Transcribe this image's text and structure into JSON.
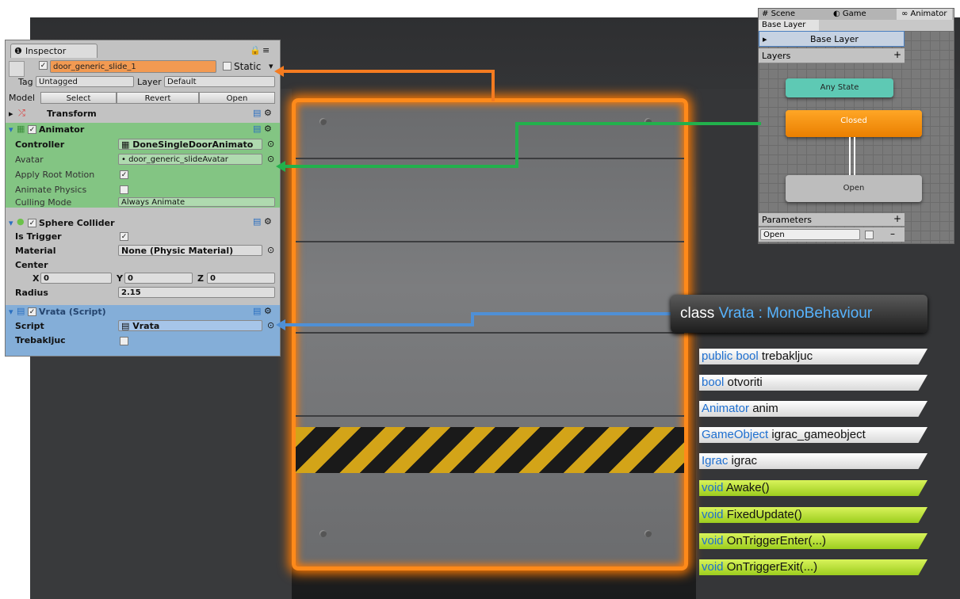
{
  "inspector": {
    "tab_label": "Inspector",
    "object_name": "door_generic_slide_1",
    "static_label": "Static",
    "tag_label": "Tag",
    "tag_value": "Untagged",
    "layer_label": "Layer",
    "layer_value": "Default",
    "model_label": "Model",
    "select_btn": "Select",
    "revert_btn": "Revert",
    "open_btn": "Open",
    "transform": {
      "title": "Transform"
    },
    "animator": {
      "title": "Animator",
      "controller_label": "Controller",
      "controller_value": "DoneSingleDoorAnimato",
      "avatar_label": "Avatar",
      "avatar_value": "door_generic_slideAvatar",
      "apply_root_motion_label": "Apply Root Motion",
      "animate_physics_label": "Animate Physics",
      "culling_mode_label": "Culling Mode",
      "culling_mode_value": "Always Animate"
    },
    "sphere_collider": {
      "title": "Sphere Collider",
      "is_trigger_label": "Is Trigger",
      "material_label": "Material",
      "material_value": "None (Physic Material)",
      "center_label": "Center",
      "x_label": "X",
      "x_value": "0",
      "y_label": "Y",
      "y_value": "0",
      "z_label": "Z",
      "z_value": "0",
      "radius_label": "Radius",
      "radius_value": "2.15"
    },
    "script": {
      "title": "Vrata (Script)",
      "script_label": "Script",
      "script_value": "Vrata",
      "trebakljuc_label": "Trebakljuc"
    }
  },
  "animator_window": {
    "tabs": [
      "Scene",
      "Game",
      "Animator"
    ],
    "breadcrumb": "Base Layer",
    "layer_row": "Base Layer",
    "layers_label": "Layers",
    "states": {
      "any": "Any State",
      "closed": "Closed",
      "open": "Open"
    },
    "parameters_label": "Parameters",
    "param_name": "Open"
  },
  "code": {
    "class_kw": "class",
    "class_name": "Vrata : MonoBehaviour",
    "fields": [
      {
        "kw": "public bool",
        "name": "trebakljuc"
      },
      {
        "kw": "bool",
        "name": "otvoriti"
      },
      {
        "kw": "Animator",
        "name": "anim"
      },
      {
        "kw": "GameObject",
        "name": "igrac_gameobject"
      },
      {
        "kw": "Igrac",
        "name": "igrac"
      }
    ],
    "methods": [
      {
        "kw": "void",
        "name": "Awake()"
      },
      {
        "kw": "void",
        "name": "FixedUpdate()"
      },
      {
        "kw": "void",
        "name": "OnTriggerEnter(...)"
      },
      {
        "kw": "void",
        "name": "OnTriggerExit(...)"
      }
    ]
  },
  "colors": {
    "orange": "#ff8a1a",
    "green": "#22b14c",
    "blue": "#4f90d6",
    "closed_state": "#f28c00",
    "any_state": "#5ec9b4"
  }
}
